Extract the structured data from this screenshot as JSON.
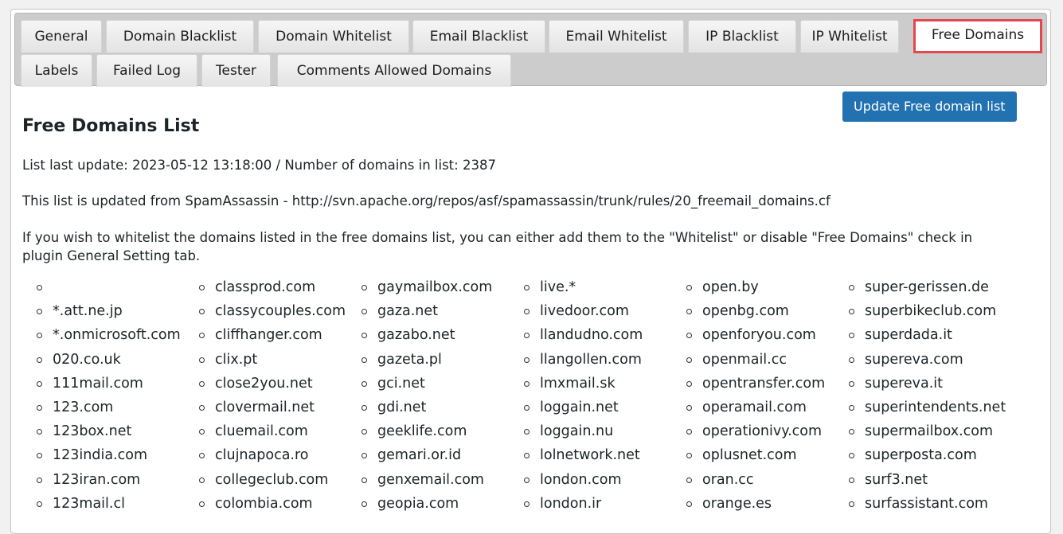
{
  "tabs": {
    "row1": [
      {
        "label": "General"
      },
      {
        "label": "Domain Blacklist"
      },
      {
        "label": "Domain Whitelist"
      },
      {
        "label": "Email Blacklist"
      },
      {
        "label": "Email Whitelist"
      },
      {
        "label": "IP Blacklist"
      },
      {
        "label": "IP Whitelist"
      },
      {
        "label": "Free Domains",
        "active": true
      }
    ],
    "row2": [
      {
        "label": "Labels"
      },
      {
        "label": "Failed Log"
      },
      {
        "label": "Tester"
      },
      {
        "label": "Comments Allowed Domains"
      }
    ],
    "highlight_color": "#e5474e"
  },
  "main": {
    "title": "Free Domains List",
    "update_button": "Update Free domain list",
    "update_button_color": "#2271b1",
    "last_update_line": "List last update: 2023-05-12 13:18:00 / Number of domains in list: 2387",
    "last_update": "2023-05-12 13:18:00",
    "domain_count": 2387,
    "source_line": "This list is updated from SpamAssassin - http://svn.apache.org/repos/asf/spamassassin/trunk/rules/20_freemail_domains.cf",
    "whitelist_note": "If you wish to whitelist the domains listed in the free domains list, you can either add them to the \"Whitelist\" or disable \"Free Domains\" check in plugin General Setting tab."
  },
  "domains": {
    "columns": [
      [
        "",
        "*.att.ne.jp",
        "*.onmicrosoft.com",
        "020.co.uk",
        "111mail.com",
        "123.com",
        "123box.net",
        "123india.com",
        "123iran.com",
        "123mail.cl"
      ],
      [
        "classprod.com",
        "classycouples.com",
        "cliffhanger.com",
        "clix.pt",
        "close2you.net",
        "clovermail.net",
        "cluemail.com",
        "clujnapoca.ro",
        "collegeclub.com",
        "colombia.com"
      ],
      [
        "gaymailbox.com",
        "gaza.net",
        "gazabo.net",
        "gazeta.pl",
        "gci.net",
        "gdi.net",
        "geeklife.com",
        "gemari.or.id",
        "genxemail.com",
        "geopia.com"
      ],
      [
        "live.*",
        "livedoor.com",
        "llandudno.com",
        "llangollen.com",
        "lmxmail.sk",
        "loggain.net",
        "loggain.nu",
        "lolnetwork.net",
        "london.com",
        "london.ir"
      ],
      [
        "open.by",
        "openbg.com",
        "openforyou.com",
        "openmail.cc",
        "opentransfer.com",
        "operamail.com",
        "operationivy.com",
        "oplusnet.com",
        "oran.cc",
        "orange.es"
      ],
      [
        "super-gerissen.de",
        "superbikeclub.com",
        "superdada.it",
        "supereva.com",
        "supereva.it",
        "superintendents.net",
        "supermailbox.com",
        "superposta.com",
        "surf3.net",
        "surfassistant.com"
      ]
    ]
  }
}
